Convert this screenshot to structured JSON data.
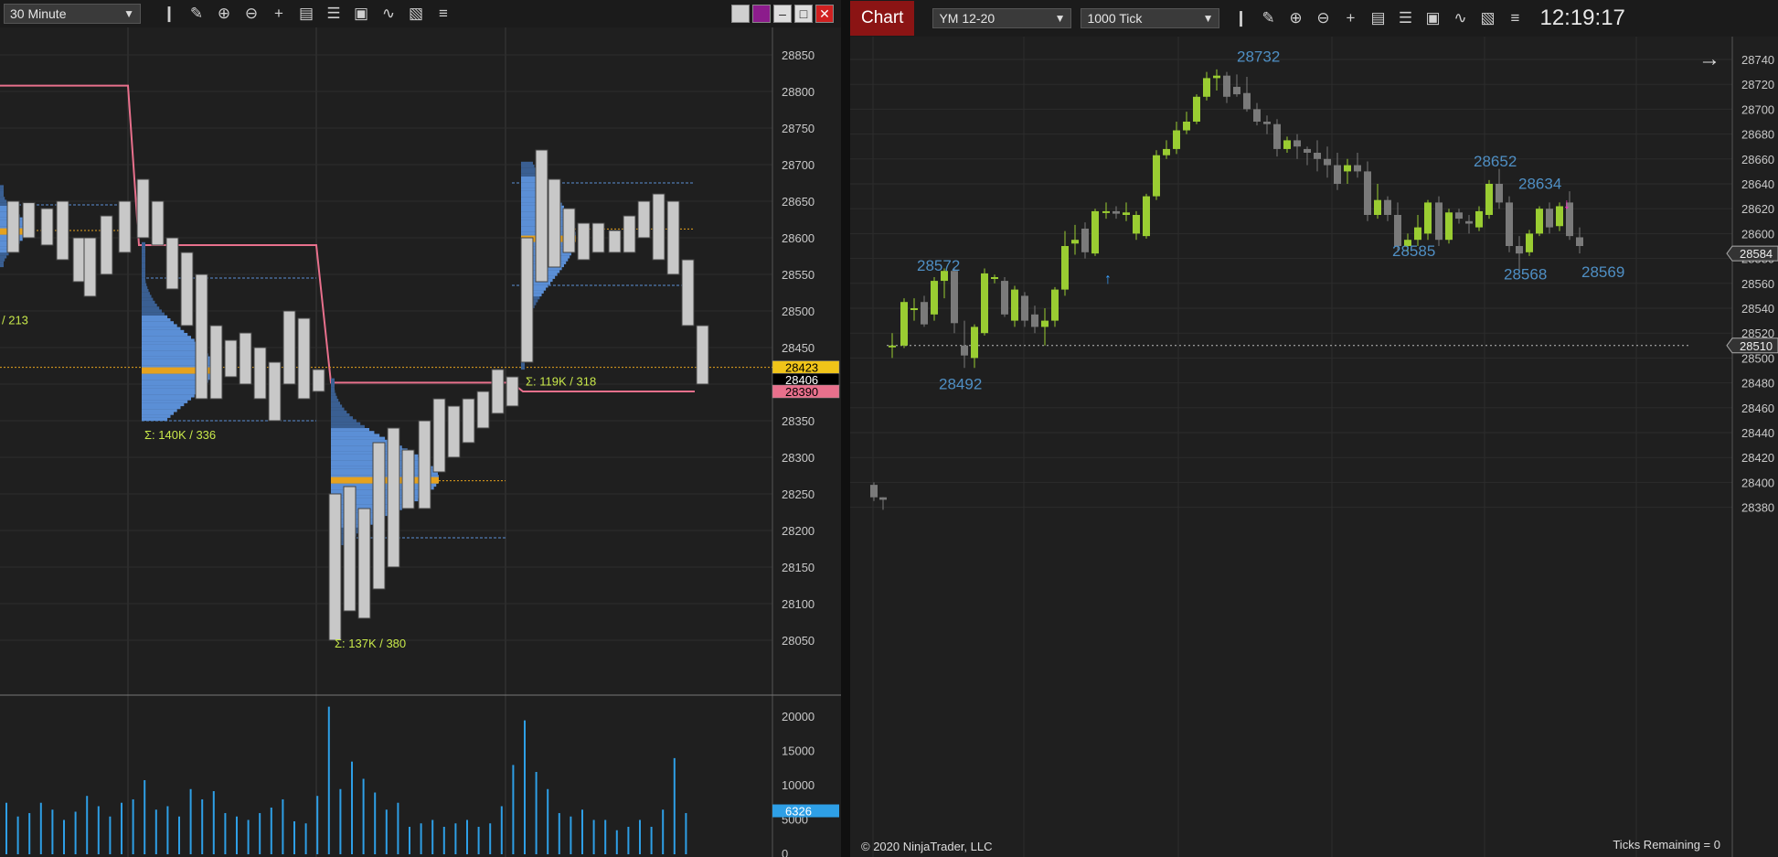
{
  "left_window": {
    "timeframe_select": "30 Minute",
    "toolbar_icons": [
      "bar-type-icon",
      "draw-pencil-icon",
      "zoom-in-icon",
      "zoom-out-icon",
      "crosshair-icon",
      "data-box-icon",
      "properties-icon",
      "indicators-icon",
      "strategies-icon",
      "templates-icon",
      "list-icon"
    ],
    "price_axis_ticks": [
      "28850",
      "28800",
      "28750",
      "28700",
      "28650",
      "28600",
      "28550",
      "28500",
      "28450",
      "28400",
      "28350",
      "28300",
      "28250",
      "28200",
      "28150",
      "28100",
      "28050"
    ],
    "price_markers": [
      {
        "label": "28423",
        "color": "#f0c419",
        "text_color": "#000000"
      },
      {
        "label": "28406",
        "color": "#000000",
        "text_color": "#ffffff"
      },
      {
        "label": "28390",
        "color": "#e8708c",
        "text_color": "#000000"
      }
    ],
    "volume_axis_ticks": [
      "20000",
      "15000",
      "10000",
      "5000",
      "0"
    ],
    "volume_marker": "6326",
    "profile_labels": [
      "/ 213",
      "Σ: 140K / 336",
      "Σ: 137K / 380",
      "Σ: 119K / 318"
    ],
    "colors": {
      "up_bar": "#c8c8c8",
      "profile_blue": "#5b8fd6",
      "profile_dark": "#3a5f92",
      "poc": "#e6a21e",
      "pink_line": "#e8708c",
      "volume": "#2e9fe6",
      "label_green": "#c8e84a"
    }
  },
  "right_window": {
    "tab_label": "Chart",
    "instrument_select": "YM 12-20",
    "interval_select": "1000 Tick",
    "clock": "12:19:17",
    "toolbar_icons": [
      "bar-type-icon",
      "draw-pencil-icon",
      "zoom-in-icon",
      "zoom-out-icon",
      "crosshair-icon",
      "data-box-icon",
      "properties-icon",
      "indicators-icon",
      "strategies-icon",
      "templates-icon",
      "list-icon"
    ],
    "price_axis_ticks": [
      "28740",
      "28720",
      "28700",
      "28680",
      "28660",
      "28640",
      "28620",
      "28600",
      "28580",
      "28560",
      "28540",
      "28520",
      "28500",
      "28480",
      "28460",
      "28440",
      "28420",
      "28400",
      "28380"
    ],
    "price_markers": [
      "28584",
      "28510"
    ],
    "swing_labels": [
      "28732",
      "28572",
      "28492",
      "28652",
      "28634",
      "28585",
      "28568",
      "28569"
    ],
    "copyright": "© 2020 NinjaTrader, LLC",
    "ticks_remaining": "Ticks Remaining = 0",
    "colors": {
      "up": "#9acd32",
      "down": "#7a7a7a",
      "swing_label": "#4f8fc4"
    }
  }
}
